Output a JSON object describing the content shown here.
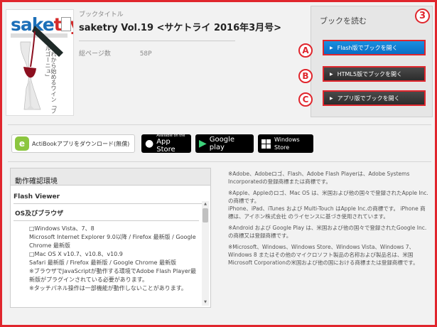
{
  "book": {
    "cover_logo_a": "sake",
    "cover_logo_b": "try",
    "cover_vertical_text": "これから始めるワイン「ブルゴーニュ」",
    "title_label": "ブックタイトル",
    "title": "saketry Vol.19 <サケトライ 2016年3月号>",
    "pages_label": "総ページ数",
    "pages_value": "58P"
  },
  "read": {
    "heading": "ブックを読む",
    "step_number": "3",
    "buttons": [
      {
        "marker": "A",
        "label": "Flash版でブックを開く"
      },
      {
        "marker": "B",
        "label": "HTML5版でブックを開く"
      },
      {
        "marker": "C",
        "label": "アプリ版でブックを開く"
      }
    ]
  },
  "appbar": {
    "download_label": "ActiBookアプリをダウンロード(無償)",
    "app_store_small": "Available on the",
    "app_store_big": "App Store",
    "google_play": "Google play",
    "windows_store_line1": "Windows",
    "windows_store_line2": "Store"
  },
  "env": {
    "heading": "動作確認環境",
    "subheading": "Flash Viewer",
    "os_heading": "OS及びブラウザ",
    "lines": [
      "□Windows Vista、7、8",
      "Microsoft Internet Explorer 9.0以降 / Firefox 最新版 / Google Chrome 最新版",
      "□Mac OS X v10.7、v10.8、v10.9",
      "Safari 最新版 / Firefox 最新版 / Google Chrome 最新版",
      "※ブラウザでJavaScriptが動作する環境でAdobe Flash Player最新版がプラグインされている必要があります。",
      "※タッチパネル操作は一部機能が動作しないことがあります。"
    ]
  },
  "notes": [
    "※Adobe、Adobeロゴ、Flash、Adobe Flash Playerは、Adobe Systems Incorporatedの登録商標または商標です。",
    "※Apple、Appleのロゴ、Mac OS は、米国および他の国々で登録されたApple Inc.の商標です。",
    "iPhone、iPad、iTunes および Multi-Touch はApple Inc.の商標です。 iPhone 商標は、アイホン株式会社 のライセンスに基づき使用されています。",
    "※Android および Google Play は、米国および他の国々で登録されたGoogle Inc.の商標又は登録商標です。",
    "※Microsoft、Windows、Windows Store、Windows Vista、Windows 7、Windows 8 またはその他のマイクロソフト製品の名称および製品名は、米国 Microsoft Corporationの米国および他の国における商標または登録商標です。"
  ]
}
